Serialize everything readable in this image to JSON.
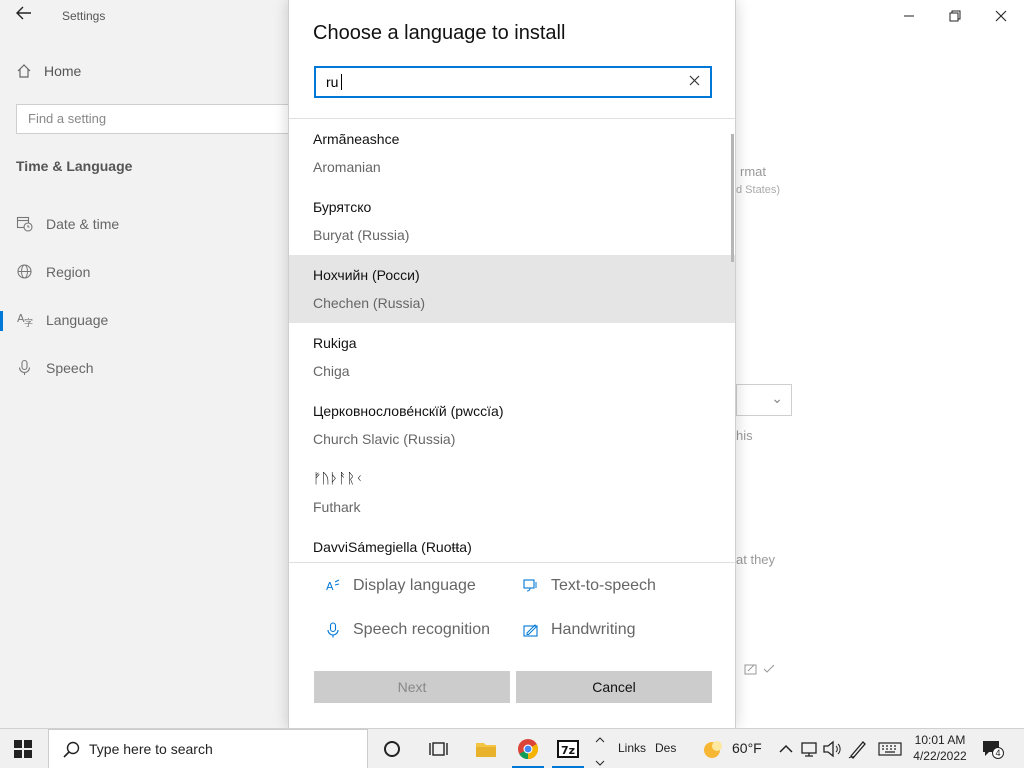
{
  "window": {
    "title": "Settings",
    "home_label": "Home",
    "find_placeholder": "Find a setting",
    "section_title": "Time & Language",
    "nav": [
      {
        "label": "Date & time",
        "icon": "calendar-clock-icon"
      },
      {
        "label": "Region",
        "icon": "globe-icon"
      },
      {
        "label": "Language",
        "icon": "language-icon",
        "active": true
      },
      {
        "label": "Speech",
        "icon": "microphone-icon"
      }
    ],
    "bg_fragments": [
      "rmat",
      "d States)",
      "his",
      "at they"
    ]
  },
  "dialog": {
    "title": "Choose a language to install",
    "search_value": "ru",
    "languages": [
      {
        "native": "Armãneashce",
        "english": "Aromanian"
      },
      {
        "native": "Бурятско",
        "english": "Buryat (Russia)"
      },
      {
        "native": "Нохчийн (Росси)",
        "english": "Chechen (Russia)",
        "highlighted": true
      },
      {
        "native": "Rukiga",
        "english": "Chiga"
      },
      {
        "native": "Церковнослове́нскїй (рwссїа)",
        "english": "Church Slavic (Russia)"
      },
      {
        "native": "ᚠᚢᚦᚨᚱᚲ",
        "english": "Futhark"
      },
      {
        "native": "DavviSámegiella (Ruoŧŧa)",
        "english": ""
      }
    ],
    "features": {
      "display_language": "Display language",
      "text_to_speech": "Text-to-speech",
      "speech_recognition": "Speech recognition",
      "handwriting": "Handwriting"
    },
    "next_label": "Next",
    "cancel_label": "Cancel"
  },
  "taskbar": {
    "search_placeholder": "Type here to search",
    "links_label": "Links",
    "des_label": "Des",
    "weather": "60°F",
    "time": "10:01 AM",
    "date": "4/22/2022",
    "notification_count": "4"
  },
  "colors": {
    "accent": "#0078d7",
    "highlight_row": "#e5e5e5",
    "button_bg": "#cccccc"
  }
}
